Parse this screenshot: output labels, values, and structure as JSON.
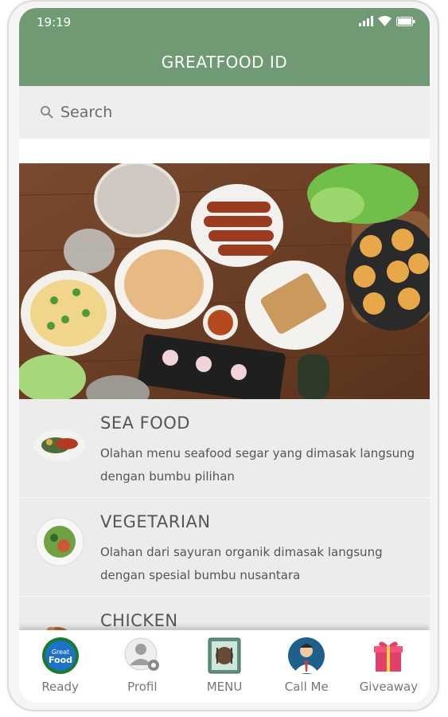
{
  "status": {
    "time": "19:19"
  },
  "app": {
    "title": "GREATFOOD ID"
  },
  "search": {
    "placeholder": "Search"
  },
  "categories": [
    {
      "title": "SEA FOOD",
      "desc": "Olahan menu seafood segar yang dimasak langsung dengan bumbu pilihan"
    },
    {
      "title": "VEGETARIAN",
      "desc": "Olahan dari sayuran organik dimasak langsung dengan spesial bumbu nusantara"
    },
    {
      "title": "CHICKEN",
      "desc": ""
    }
  ],
  "nav": [
    {
      "label": "Ready",
      "icon": "great-food-logo-icon"
    },
    {
      "label": "Profil",
      "icon": "profile-gear-icon"
    },
    {
      "label": "MENU",
      "icon": "menu-plate-icon"
    },
    {
      "label": "Call Me",
      "icon": "support-agent-icon"
    },
    {
      "label": "Giveaway",
      "icon": "gift-icon"
    }
  ],
  "logo_text": {
    "line1": "Great",
    "line2": "Food"
  },
  "colors": {
    "brand": "#6f9a73",
    "list_bg": "#ececec",
    "text": "#555555"
  }
}
